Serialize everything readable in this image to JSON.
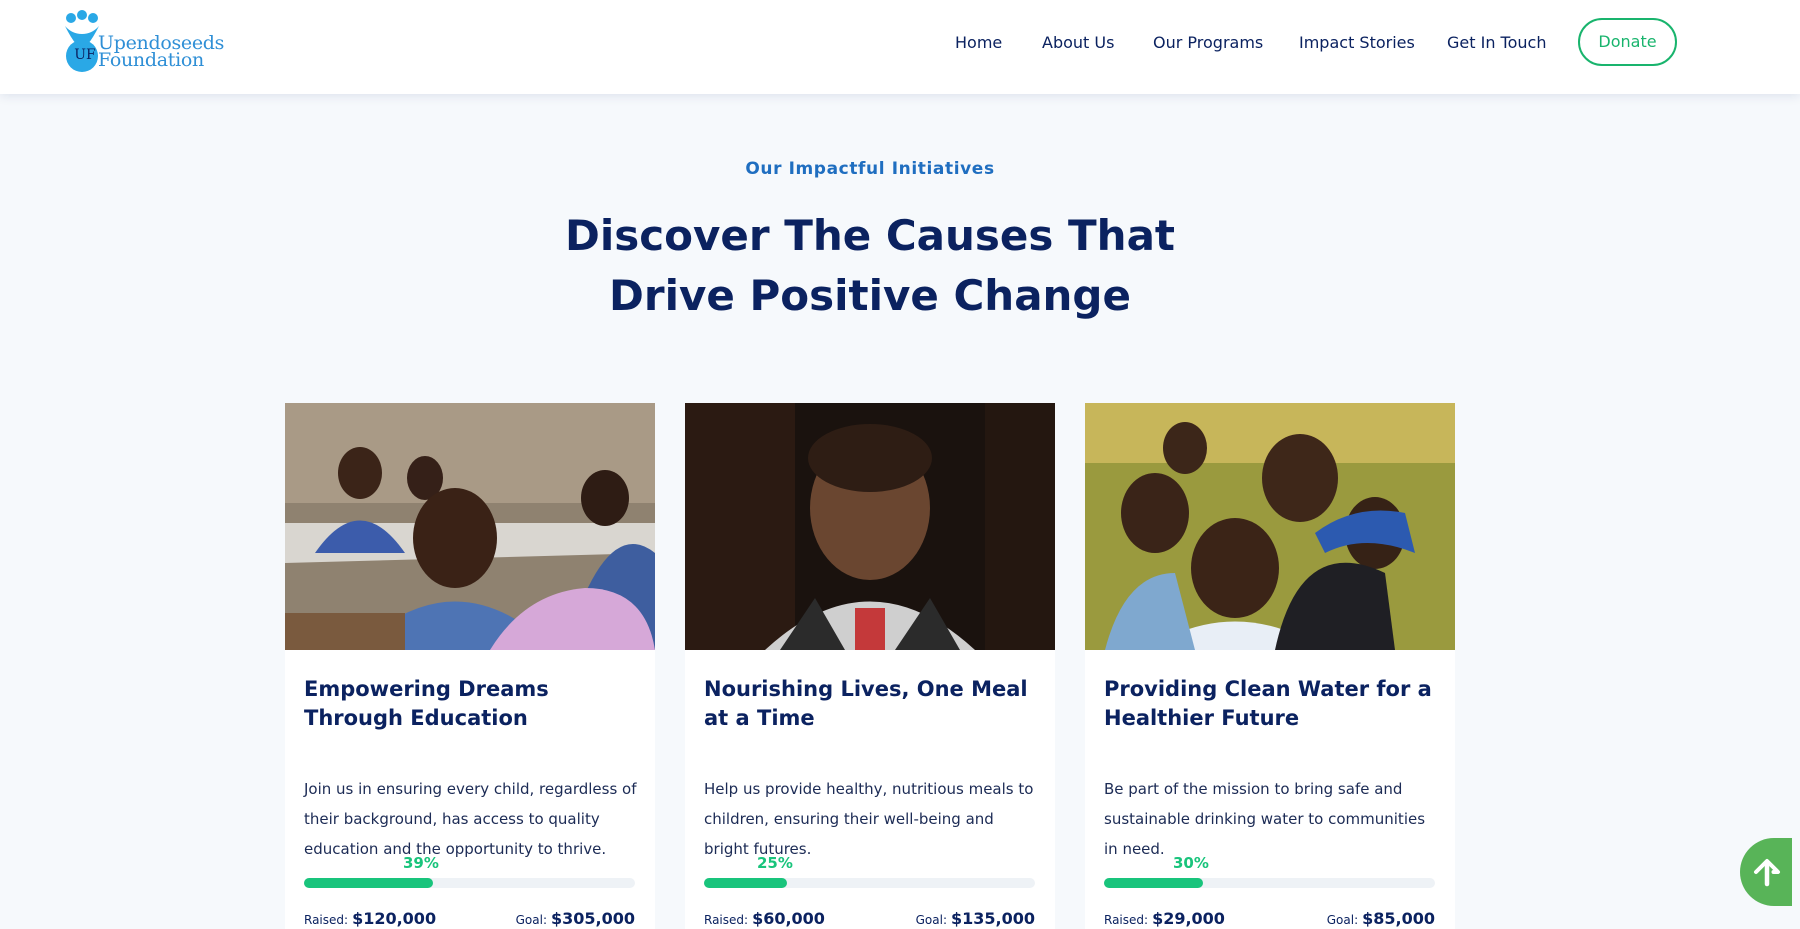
{
  "header": {
    "logo_line_1": "Upendoseeds",
    "logo_line_2": "Foundation",
    "logo_initials": "UF",
    "nav": [
      "Home",
      "About Us",
      "Our Programs",
      "Impact Stories",
      "Get In Touch"
    ],
    "donate_label": "Donate"
  },
  "section": {
    "eyebrow": "Our Impactful Initiatives",
    "headline_line_1": "Discover The Causes That",
    "headline_line_2": "Drive Positive Change"
  },
  "causes": [
    {
      "title": "Empowering Dreams Through Education",
      "description": "Join us in ensuring every child, regardless of their background, has access to quality education and the opportunity to thrive.",
      "percent_label": "39%",
      "progress": 0.39,
      "raised_label": "Raised:",
      "raised": "$120,000",
      "goal_label": "Goal:",
      "goal": "$305,000"
    },
    {
      "title": "Nourishing Lives, One Meal at a Time",
      "description": "Help us provide healthy, nutritious meals to children, ensuring their well-being and bright futures.",
      "percent_label": "25%",
      "progress": 0.25,
      "raised_label": "Raised:",
      "raised": "$60,000",
      "goal_label": "Goal:",
      "goal": "$135,000"
    },
    {
      "title": "Providing Clean Water for a Healthier Future",
      "description": "Be part of the mission to bring safe and sustainable drinking water to communities in need.",
      "percent_label": "30%",
      "progress": 0.3,
      "raised_label": "Raised:",
      "raised": "$29,000",
      "goal_label": "Goal:",
      "goal": "$85,000"
    }
  ],
  "colors": {
    "brand_navy": "#0b2260",
    "accent_green": "#19c47c",
    "link_blue": "#1f6ec0",
    "scroll_button": "#58b458"
  },
  "icons": {
    "scroll_top": "arrow-up-icon"
  }
}
